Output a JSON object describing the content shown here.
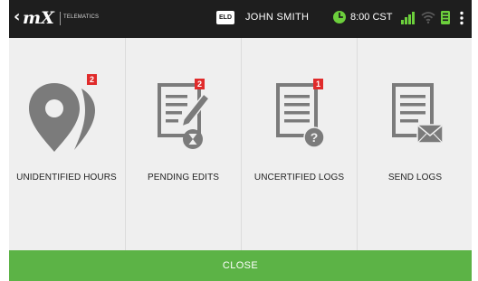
{
  "status_bar": {
    "logo_text": "mX",
    "logo_subtitle": "TELEMATICS",
    "eld_badge": "ELD",
    "driver_name": "JOHN SMITH",
    "time": "8:00 CST",
    "icons": [
      "back-chevron-icon",
      "clock-icon",
      "signal-icon",
      "wifi-icon",
      "device-icon",
      "menu-icon"
    ],
    "accent_color": "#6ccf3c"
  },
  "tiles": [
    {
      "label": "UNIDENTIFIED HOURS",
      "badge": "2",
      "icon": "map-pin-icon"
    },
    {
      "label": "PENDING EDITS",
      "badge": "2",
      "icon": "edit-document-icon"
    },
    {
      "label": "UNCERTIFIED LOGS",
      "badge": "1",
      "icon": "document-question-icon"
    },
    {
      "label": "SEND LOGS",
      "badge": "",
      "icon": "document-mail-icon"
    }
  ],
  "footer": {
    "close_label": "CLOSE"
  },
  "colors": {
    "status_bar_bg": "#1e1e1e",
    "tile_bg": "#efefef",
    "icon_gray": "#7b7b7b",
    "badge_red": "#e02b2b",
    "close_green": "#5cb346"
  }
}
